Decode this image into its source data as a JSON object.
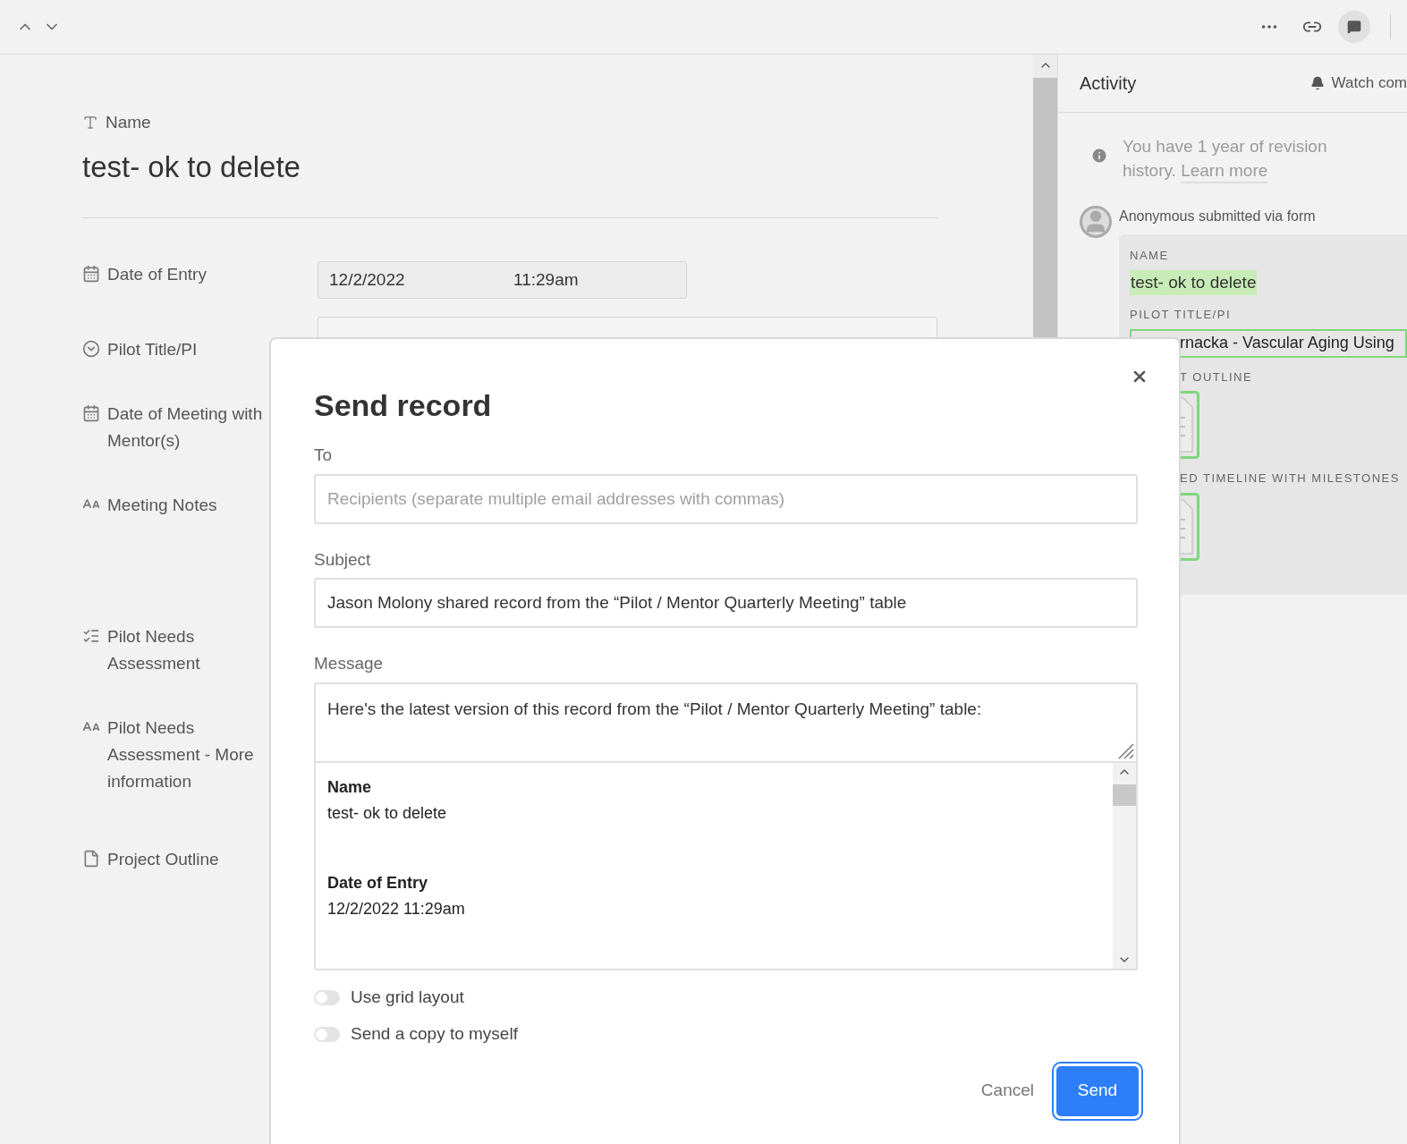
{
  "record": {
    "title_label": "Name",
    "title": "test- ok to delete",
    "fields": [
      {
        "kind": "datetime",
        "label": "Date of Entry",
        "date": "12/2/2022",
        "time": "11:29am"
      },
      {
        "kind": "select",
        "label": "Pilot Title/PI"
      },
      {
        "kind": "date",
        "label": "Date of Meeting with Mentor(s)"
      },
      {
        "kind": "longtext",
        "label": "Meeting Notes"
      },
      {
        "kind": "multiselect",
        "label": "Pilot Needs Assessment"
      },
      {
        "kind": "longtext",
        "label": "Pilot Needs Assessment - More information"
      },
      {
        "kind": "attachment",
        "label": "Project Outline"
      }
    ]
  },
  "activity": {
    "title": "Activity",
    "watch": "Watch com",
    "notice": "You have 1 year of revision history.",
    "notice_link": "Learn more",
    "author_line": "Anonymous submitted via form",
    "entries": [
      {
        "kind": "highlight",
        "label": "NAME",
        "value": "test- ok to delete"
      },
      {
        "kind": "boxed",
        "label": "PILOT TITLE/PI",
        "value": "rnacka - Vascular Aging Using"
      },
      {
        "kind": "attachment",
        "label": "T OUTLINE"
      },
      {
        "kind": "attachment",
        "label": "ED TIMELINE WITH MILESTONES"
      }
    ]
  },
  "dialog": {
    "title": "Send record",
    "to_label": "To",
    "to_placeholder": "Recipients (separate multiple email addresses with commas)",
    "subject_label": "Subject",
    "subject": "Jason Molony shared record from the “Pilot / Mentor Quarterly Meeting” table",
    "message_label": "Message",
    "message": "Here's the latest version of this record from the “Pilot / Mentor Quarterly Meeting” table:",
    "preview": [
      {
        "label": "Name",
        "value": "test- ok to delete"
      },
      {
        "label": "Date of Entry",
        "value": "12/2/2022 11:29am"
      }
    ],
    "toggles": [
      {
        "label": "Use grid layout",
        "on": false
      },
      {
        "label": "Send a copy to myself",
        "on": false
      }
    ],
    "cancel": "Cancel",
    "send": "Send"
  }
}
